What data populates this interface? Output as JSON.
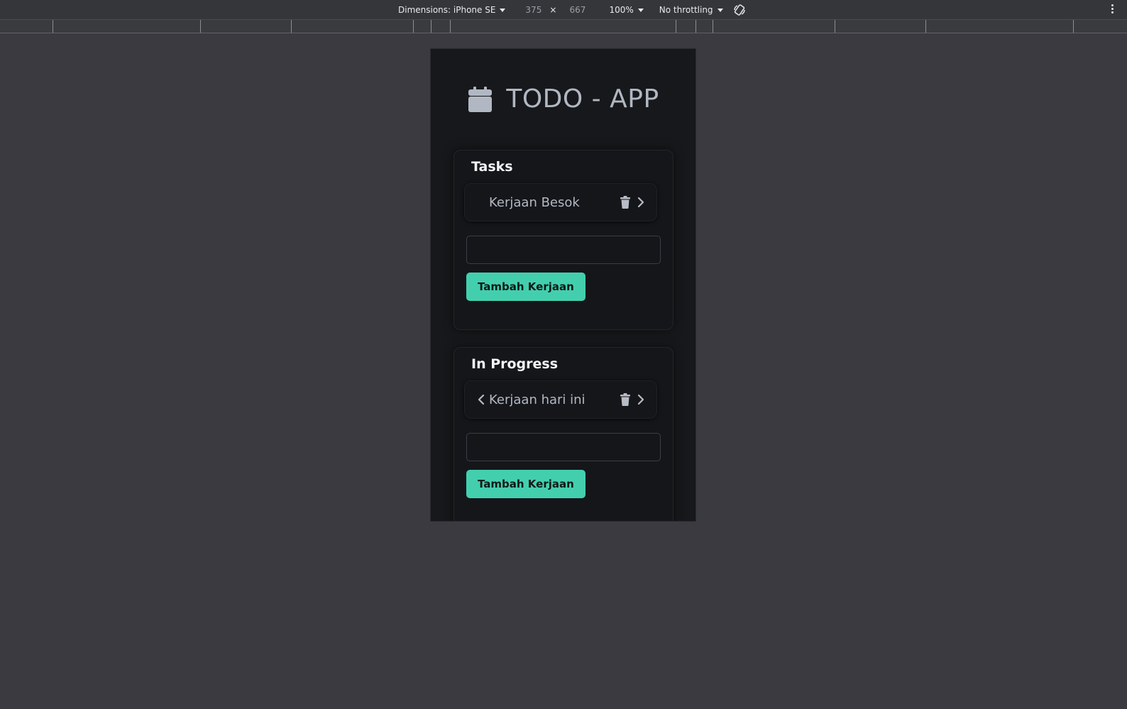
{
  "devtools": {
    "dimensions_label": "Dimensions: iPhone SE",
    "width": "375",
    "times": "×",
    "height": "667",
    "zoom": "100%",
    "throttling": "No throttling",
    "rotate_icon": "rotate-icon",
    "more_icon": "more-vertical-icon"
  },
  "app": {
    "title": "TODO - APP",
    "title_icon": "calendar-icon",
    "accent_color": "#43cfae",
    "background_color": "#17181b"
  },
  "columns": [
    {
      "title": "Tasks",
      "tasks": [
        {
          "label": "Kerjaan Besok",
          "has_prev": false,
          "has_next": true
        }
      ],
      "input_value": "",
      "add_button_label": "Tambah Kerjaan"
    },
    {
      "title": "In Progress",
      "tasks": [
        {
          "label": "Kerjaan hari ini",
          "has_prev": true,
          "has_next": true
        }
      ],
      "input_value": "",
      "add_button_label": "Tambah Kerjaan"
    }
  ]
}
